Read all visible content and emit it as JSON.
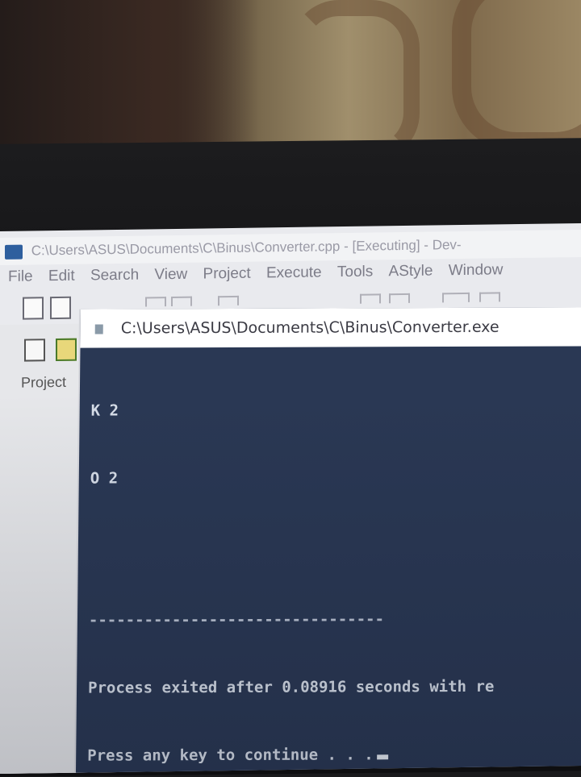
{
  "ide": {
    "title": "C:\\Users\\ASUS\\Documents\\C\\Binus\\Converter.cpp - [Executing] - Dev-",
    "menu": [
      "File",
      "Edit",
      "Search",
      "View",
      "Project",
      "Execute",
      "Tools",
      "AStyle",
      "Window"
    ],
    "project_label": "Project"
  },
  "console": {
    "title": "C:\\Users\\ASUS\\Documents\\C\\Binus\\Converter.exe",
    "lines": [
      "K 2",
      "O 2",
      "",
      "--------------------------------",
      "Process exited after 0.08916 seconds with re",
      "Press any key to continue . . ."
    ]
  },
  "colors": {
    "console_bg": "#2a3854",
    "console_text": "#d6dde8",
    "ide_bg": "#e9eaee"
  },
  "icons": [
    "app-icon",
    "new-file-icon",
    "open-file-icon",
    "back-icon",
    "add-icon",
    "console-icon"
  ]
}
